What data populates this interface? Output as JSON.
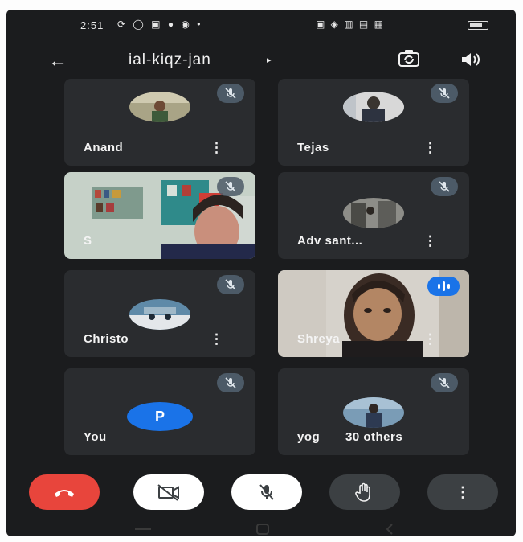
{
  "status_bar": {
    "time": "2:51",
    "left_icons_text": "⟳ ◯ ▣ ● ◉ •",
    "right_icons_text": "▣ ◈ ▥ ▤ ▦"
  },
  "header": {
    "back_icon": "arrow-left-icon",
    "meeting_code": "ial-kiqz-jan",
    "caret": "▸",
    "switch_camera_icon": "switch-camera-icon",
    "speaker_icon": "speaker-icon"
  },
  "participants": [
    {
      "name": "Anand",
      "muted": true,
      "type": "avatar"
    },
    {
      "name": "Tejas",
      "muted": true,
      "type": "avatar"
    },
    {
      "name": "S",
      "muted": true,
      "type": "video"
    },
    {
      "name": "Adv sant...",
      "muted": true,
      "type": "avatar"
    },
    {
      "name": "Christo",
      "muted": true,
      "type": "avatar"
    },
    {
      "name": "Shreya",
      "muted": false,
      "speaking": true,
      "type": "video"
    },
    {
      "name": "You",
      "muted": true,
      "type": "letter",
      "letter": "P"
    },
    {
      "name": "yog",
      "others": "30 others",
      "muted": true,
      "type": "avatar"
    }
  ],
  "menu_glyph": "⋮",
  "controls": {
    "end_call_icon": "end-call-icon",
    "camera_off_icon": "camera-off-icon",
    "mic_off_icon": "mic-off-icon",
    "raise_hand_icon": "raise-hand-icon",
    "more_icon": "more-options-icon",
    "end_call_color": "#e8453c",
    "toggle_bg": "#ffffff",
    "dark_button_bg": "#3c4043"
  },
  "colors": {
    "background": "#1b1c1e",
    "tile": "#2a2c2f",
    "muted_badge": "#4c5a67",
    "accent_blue": "#1a73e8"
  }
}
